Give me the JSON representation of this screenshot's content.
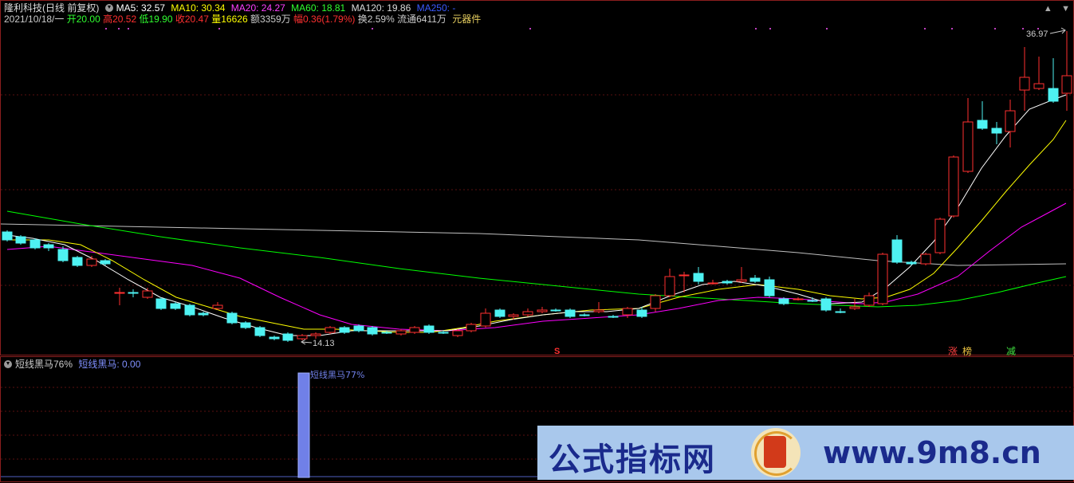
{
  "header": {
    "stock_name": "隆利科技(日线 前复权)",
    "ma5": "MA5: 32.57",
    "ma10": "MA10: 30.34",
    "ma20": "MA20: 24.27",
    "ma60": "MA60: 18.81",
    "ma120": "MA120: 19.86",
    "ma250": "MA250: -",
    "date": "2021/10/18/一",
    "open": "开20.00",
    "high": "高20.52",
    "low": "低19.90",
    "close": "收20.47",
    "volume": "量16626",
    "amount": "额3359万",
    "change": "幅0.36(1.79%)",
    "turnover": "换2.59%",
    "float": "流通6411万",
    "sector": "元器件"
  },
  "colors": {
    "ma5": "#ffffff",
    "ma10": "#ffff00",
    "ma20": "#ff00ff",
    "ma60": "#00ff00",
    "ma120": "#c0c0c0",
    "ma250": "#2a4aff",
    "up": "#ff3030",
    "down": "#4ef2f2",
    "border": "#8a1e1e"
  },
  "price_labels": {
    "high_label": "36.97",
    "low_label": "14.13"
  },
  "event_markers": {
    "s": "S",
    "zhang": "涨",
    "bang": "榜",
    "jian": "减"
  },
  "indicator": {
    "header_name": "短线黑马76%",
    "value": "短线黑马: 0.00",
    "bar_label": "短线黑马77%"
  },
  "watermark": {
    "left": "公式指标网",
    "right": "www.9m8.cn"
  }
}
